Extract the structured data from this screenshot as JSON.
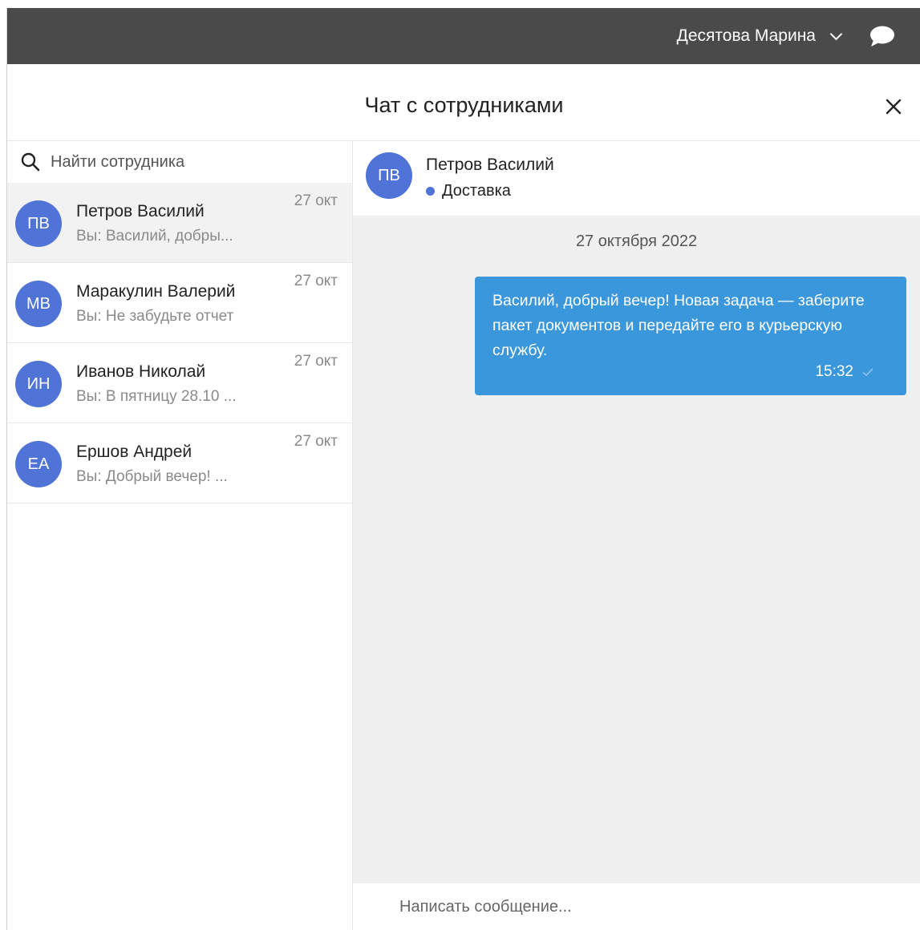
{
  "topbar": {
    "user_name": "Десятова Марина",
    "icons": {
      "dropdown": "chevron-down-icon",
      "chat": "chat-bubble-icon"
    }
  },
  "header": {
    "title": "Чат с сотрудниками",
    "close_icon": "close-icon"
  },
  "search": {
    "placeholder": "Найти сотрудника",
    "icon": "search-icon"
  },
  "contacts": [
    {
      "initials": "ПВ",
      "name": "Петров Василий",
      "preview": "Вы: Василий, добры...",
      "date": "27 окт",
      "active": true
    },
    {
      "initials": "МВ",
      "name": "Маракулин Валерий",
      "preview": "Вы: Не забудьте отчет",
      "date": "27 окт",
      "active": false
    },
    {
      "initials": "ИН",
      "name": "Иванов Николай",
      "preview": "Вы: В пятницу 28.10 ...",
      "date": "27 окт",
      "active": false
    },
    {
      "initials": "ЕА",
      "name": "Ершов Андрей",
      "preview": "Вы: Добрый вечер! ...",
      "date": "27 окт",
      "active": false
    }
  ],
  "chat": {
    "initials": "ПВ",
    "name": "Петров Василий",
    "status": "Доставка",
    "day_separator": "27 октября 2022",
    "messages": [
      {
        "text": "Василий, добрый вечер! Новая задача — заберите пакет документов и передайте его в курьерскую службу.",
        "time": "15:32",
        "outgoing": true
      }
    ],
    "composer_placeholder": "Написать сообщение..."
  },
  "colors": {
    "topbar": "#4a4a4a",
    "avatar": "#4f73d6",
    "bubble": "#3a97dc",
    "chat_bg": "#f0f0f1"
  }
}
